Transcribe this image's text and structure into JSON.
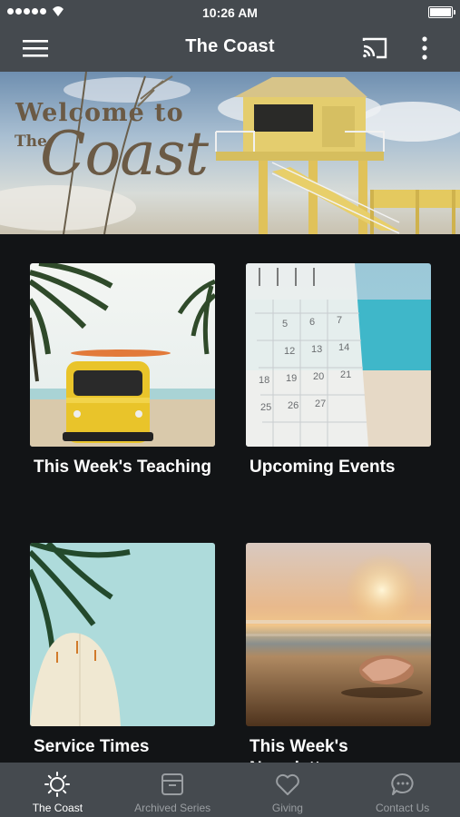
{
  "status_bar": {
    "time": "10:26 AM"
  },
  "nav": {
    "title": "The Coast"
  },
  "hero": {
    "welcome": "Welcome to",
    "the": "The",
    "coast": "Coast"
  },
  "cards": [
    {
      "label": "This Week's Teaching"
    },
    {
      "label": "Upcoming Events"
    },
    {
      "label": "Service Times"
    },
    {
      "label": "This Week's Newsletter"
    }
  ],
  "calendar_dates": [
    "5",
    "6",
    "7",
    "12",
    "13",
    "14",
    "18",
    "19",
    "20",
    "21",
    "25",
    "26",
    "27"
  ],
  "tabs": [
    {
      "label": "The Coast",
      "icon": "sun-icon",
      "active": true
    },
    {
      "label": "Archived Series",
      "icon": "archive-icon",
      "active": false
    },
    {
      "label": "Giving",
      "icon": "heart-icon",
      "active": false
    },
    {
      "label": "Contact Us",
      "icon": "chat-bubble-icon",
      "active": false
    }
  ],
  "colors": {
    "bar": "#454a4f",
    "background": "#121416",
    "tab_inactive": "#9a9ea2",
    "hero_text": "#6b5a45"
  }
}
